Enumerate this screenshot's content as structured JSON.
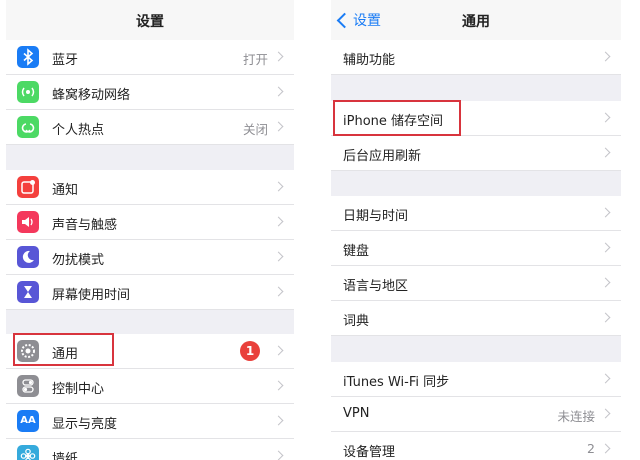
{
  "left": {
    "title": "设置",
    "items": [
      {
        "label": "蓝牙",
        "value": "打开",
        "icon": "bluetooth-icon",
        "color": "#1a7cf5"
      },
      {
        "label": "蜂窝移动网络",
        "value": "",
        "icon": "cellular-icon",
        "color": "#4cd964"
      },
      {
        "label": "个人热点",
        "value": "关闭",
        "icon": "hotspot-icon",
        "color": "#4cd964"
      },
      {
        "label": "通知",
        "value": "",
        "icon": "notifications-icon",
        "color": "#f4403d"
      },
      {
        "label": "声音与触感",
        "value": "",
        "icon": "sounds-icon",
        "color": "#f4385c"
      },
      {
        "label": "勿扰模式",
        "value": "",
        "icon": "do-not-disturb-icon",
        "color": "#5856d6"
      },
      {
        "label": "屏幕使用时间",
        "value": "",
        "icon": "screen-time-icon",
        "color": "#5856d6"
      },
      {
        "label": "通用",
        "value": "",
        "badge": "1",
        "icon": "gear-icon",
        "color": "#8e8e93"
      },
      {
        "label": "控制中心",
        "value": "",
        "icon": "control-center-icon",
        "color": "#8e8e93"
      },
      {
        "label": "显示与亮度",
        "value": "",
        "icon": "display-brightness-icon",
        "color": "#1a7cf5"
      },
      {
        "label": "墙纸",
        "value": "",
        "icon": "wallpaper-icon",
        "color": "#35aadc"
      }
    ]
  },
  "right": {
    "back_label": "设置",
    "title": "通用",
    "items": [
      {
        "label": "辅助功能",
        "value": ""
      },
      {
        "label": "iPhone 储存空间",
        "value": ""
      },
      {
        "label": "后台应用刷新",
        "value": ""
      },
      {
        "label": "日期与时间",
        "value": ""
      },
      {
        "label": "键盘",
        "value": ""
      },
      {
        "label": "语言与地区",
        "value": ""
      },
      {
        "label": "词典",
        "value": ""
      },
      {
        "label": "iTunes Wi-Fi 同步",
        "value": ""
      },
      {
        "label": "VPN",
        "value": "未连接"
      },
      {
        "label": "设备管理",
        "value": "2"
      }
    ]
  },
  "highlight_color": "#d8343d"
}
